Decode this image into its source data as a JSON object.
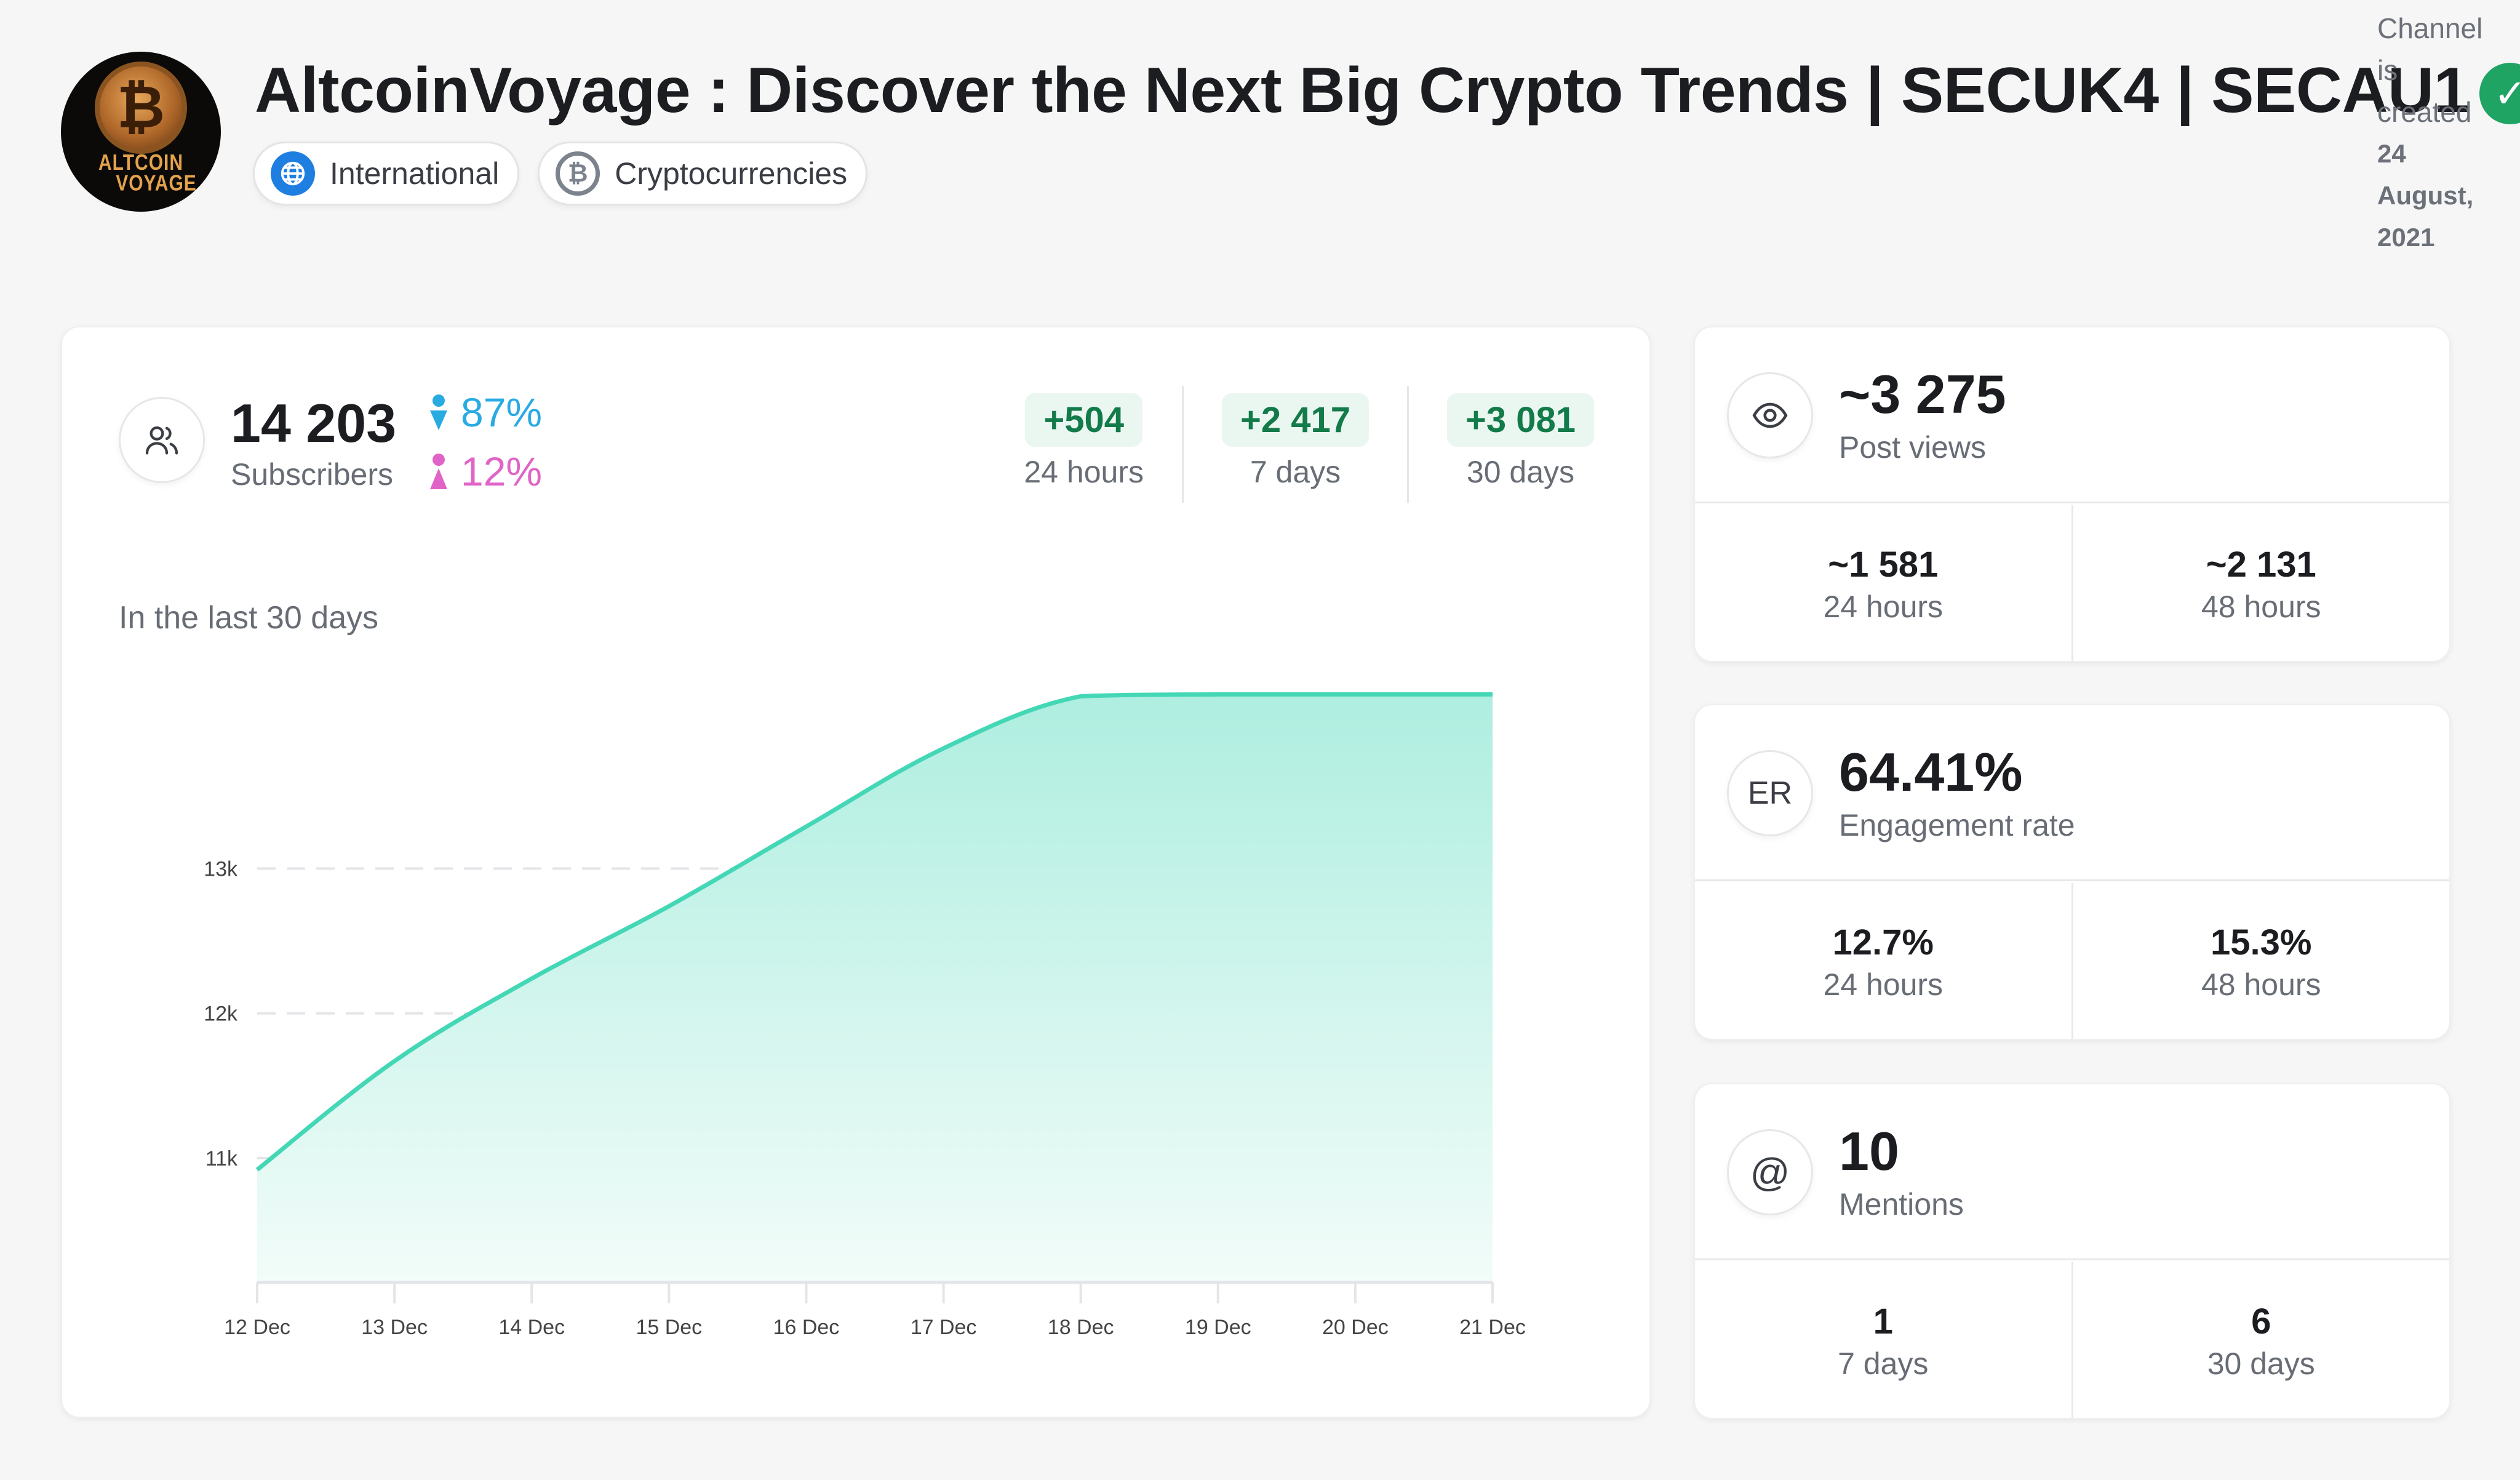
{
  "channel": {
    "title": "AltcoinVoyage : Discover the Next Big Crypto Trends | SECUK4 | SECAU1",
    "avatar_text_line1": "ALTCOIN",
    "avatar_text_line2": "VOYAGE",
    "avatar_coin_glyph": "₿",
    "verified_icon": "✓",
    "created_prefix": "Channel is created",
    "created_date": "24 August, 2021",
    "tags": [
      {
        "label": "International",
        "icon": "globe-icon"
      },
      {
        "label": "Cryptocurrencies",
        "icon": "bitcoin-icon",
        "glyph": "₿"
      }
    ]
  },
  "subscribers": {
    "count": "14 203",
    "label": "Subscribers",
    "male_pct": "87%",
    "female_pct": "12%",
    "growth": [
      {
        "value": "+504",
        "period": "24 hours"
      },
      {
        "value": "+2 417",
        "period": "7 days"
      },
      {
        "value": "+3 081",
        "period": "30 days"
      }
    ],
    "chart_title": "In the last 30 days"
  },
  "post_views": {
    "value": "~3 275",
    "label": "Post views",
    "stats": [
      {
        "value": "~1 581",
        "period": "24 hours"
      },
      {
        "value": "~2 131",
        "period": "48 hours"
      }
    ]
  },
  "engagement": {
    "icon_text": "ER",
    "value": "64.41%",
    "label": "Engagement rate",
    "stats": [
      {
        "value": "12.7%",
        "period": "24 hours"
      },
      {
        "value": "15.3%",
        "period": "48 hours"
      }
    ]
  },
  "mentions": {
    "icon_text": "@",
    "value": "10",
    "label": "Mentions",
    "stats": [
      {
        "value": "1",
        "period": "7 days"
      },
      {
        "value": "6",
        "period": "30 days"
      }
    ]
  },
  "colors": {
    "line": "#44d7b6",
    "fill_top": "#aeeee0",
    "growth_text": "#137a4a",
    "growth_bg": "#eaf7f1",
    "male": "#29abe2",
    "female": "#e064c7",
    "verified": "#1fa463"
  },
  "chart_data": {
    "type": "area",
    "title": "In the last 30 days",
    "xlabel": "",
    "ylabel": "Subscribers",
    "categories": [
      "12 Dec",
      "13 Dec",
      "14 Dec",
      "15 Dec",
      "16 Dec",
      "17 Dec",
      "18 Dec",
      "19 Dec",
      "20 Dec",
      "21 Dec"
    ],
    "series": [
      {
        "name": "Subscribers",
        "values": [
          10920,
          11670,
          12240,
          12740,
          13290,
          13830,
          14190,
          14203,
          14203,
          14203
        ]
      }
    ],
    "yticks": [
      11000,
      12000,
      13000
    ],
    "ytick_labels": [
      "11k",
      "12k",
      "13k"
    ],
    "ylim": [
      10150,
      14400
    ],
    "grid": true,
    "legend": "none"
  }
}
